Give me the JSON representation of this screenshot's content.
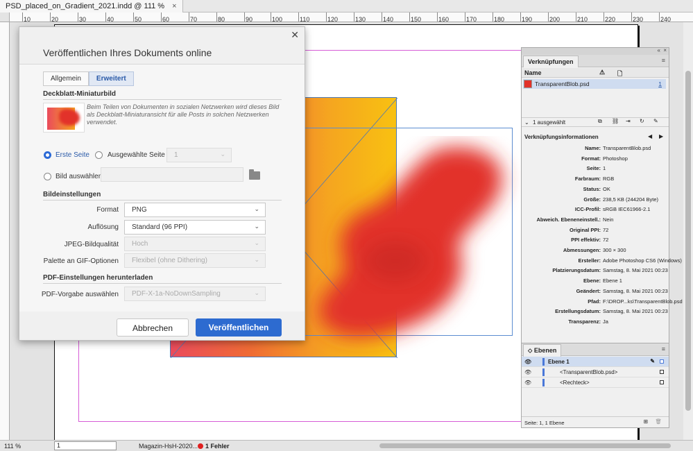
{
  "document_tab": {
    "title": "PSD_placed_on_Gradient_2021.indd @ 111 %",
    "close": "×"
  },
  "ruler": {
    "ticks": [
      "10",
      "20",
      "30",
      "40",
      "50",
      "60",
      "70",
      "80",
      "90",
      "100",
      "110",
      "120",
      "130",
      "140",
      "150",
      "160",
      "170",
      "180",
      "190",
      "200",
      "210",
      "220",
      "230",
      "240"
    ]
  },
  "status": {
    "zoom": "111 %",
    "page": "1",
    "preflight_profile": "Magazin-HsH-2020...",
    "errors": "1 Fehler"
  },
  "dialog": {
    "title": "Veröffentlichen Ihres Dokuments online",
    "tabs": [
      {
        "label": "Allgemein"
      },
      {
        "label": "Erweitert"
      }
    ],
    "cover_section": "Deckblatt-Miniaturbild",
    "cover_desc": "Beim Teilen von Dokumenten in sozialen Netzwerken wird dieses Bild als Deckblatt-Miniaturansicht für alle Posts in solchen Netzwerken verwendet.",
    "radio_first_page": "Erste Seite",
    "radio_selected_page": "Ausgewählte Seite",
    "selected_page_value": "1",
    "radio_choose_image": "Bild auswählen",
    "image_section": "Bildeinstellungen",
    "format_label": "Format",
    "format_value": "PNG",
    "resolution_label": "Auflösung",
    "resolution_value": "Standard (96 PPI)",
    "jpeg_label": "JPEG-Bildqualität",
    "jpeg_value": "Hoch",
    "gif_label": "Palette an GIF-Optionen",
    "gif_value": "Flexibel (ohne Dithering)",
    "pdf_section": "PDF-Einstellungen herunterladen",
    "pdf_preset_label": "PDF-Vorgabe auswählen",
    "pdf_preset_value": "PDF-X-1a-NoDownSampling",
    "cancel_label": "Abbrechen",
    "publish_label": "Veröffentlichen"
  },
  "links_panel": {
    "tab": "Verknüpfungen",
    "col_name": "Name",
    "file": "TransparentBlob.psd",
    "file_page": "1",
    "selected_count": "1 ausgewählt",
    "info_title": "Verknüpfungsinformationen",
    "info": [
      {
        "k": "Name:",
        "v": "TransparentBlob.psd"
      },
      {
        "k": "Format:",
        "v": "Photoshop"
      },
      {
        "k": "Seite:",
        "v": "1"
      },
      {
        "k": "Farbraum:",
        "v": "RGB"
      },
      {
        "k": "Status:",
        "v": "OK"
      },
      {
        "k": "Größe:",
        "v": "238,5 KB (244204 Byte)"
      },
      {
        "k": "ICC-Profil:",
        "v": "sRGB IEC61966-2.1"
      },
      {
        "k": "Abweich. Ebeneneinstell.:",
        "v": "Nein"
      },
      {
        "k": "Original PPI:",
        "v": "72"
      },
      {
        "k": "PPI effektiv:",
        "v": "72"
      },
      {
        "k": "Abmessungen:",
        "v": "300 × 300"
      },
      {
        "k": "Ersteller:",
        "v": "Adobe Photoshop CS6 (Windows)"
      },
      {
        "k": "Platzierungsdatum:",
        "v": "Samstag, 8. Mai 2021 00:23"
      },
      {
        "k": "Ebene:",
        "v": "Ebene 1"
      },
      {
        "k": "Geändert:",
        "v": "Samstag, 8. Mai 2021 00:23"
      },
      {
        "k": "Pfad:",
        "v": "F:\\DROP...ks\\TransparentBlob.psd"
      },
      {
        "k": "Erstellungsdatum:",
        "v": "Samstag, 8. Mai 2021 00:23"
      },
      {
        "k": "Transparenz:",
        "v": "Ja"
      }
    ]
  },
  "layers_panel": {
    "tab": "Ebenen",
    "layer": "Ebene 1",
    "items": [
      {
        "label": "<TransparentBlob.psd>"
      },
      {
        "label": "<Rechteck>"
      }
    ],
    "footer": "Seite: 1, 1 Ebene"
  },
  "colors": {
    "accent": "#2d6bd0",
    "blob": "#e2322a",
    "margin_guide": "#d65cd6"
  }
}
